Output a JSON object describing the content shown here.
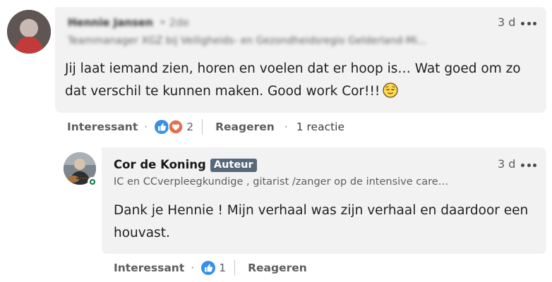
{
  "comment1": {
    "author_name": "Hennie Jansen",
    "degree": "• 2de",
    "headline": "Teammanager XGZ bij Veiligheids- en Gezondheidsregio Gelderland-Mi...",
    "time": "3 d",
    "text_line1": "Jij laat iemand zien, horen en voelen dat er hoop is… Wat goed om zo",
    "text_line2": "dat verschil te kunnen maken. Good work Cor!!!",
    "actions": {
      "like_label": "Interessant",
      "reaction_count": "2",
      "reply_label": "Reageren",
      "replies_count": "1 reactie"
    }
  },
  "comment2": {
    "author_name": "Cor de Koning",
    "badge": "Auteur",
    "headline": "IC en CCverpleegkundige , gitarist /zanger op de intensive care…",
    "time": "3 d",
    "text_line1": "Dank je Hennie ! Mijn verhaal was zijn verhaal en daardoor een",
    "text_line2": "houvast.",
    "actions": {
      "like_label": "Interessant",
      "reaction_count": "1",
      "reply_label": "Reageren"
    }
  },
  "colors": {
    "bubble_bg": "#f2f2f2",
    "badge_bg": "#56687a",
    "like_blue": "#378fe9",
    "love_red": "#df704d",
    "online_green": "#057642"
  },
  "icons": [
    "more-options-icon",
    "like-reaction-icon",
    "love-reaction-icon",
    "relieved-emoji-icon",
    "online-status-icon"
  ]
}
